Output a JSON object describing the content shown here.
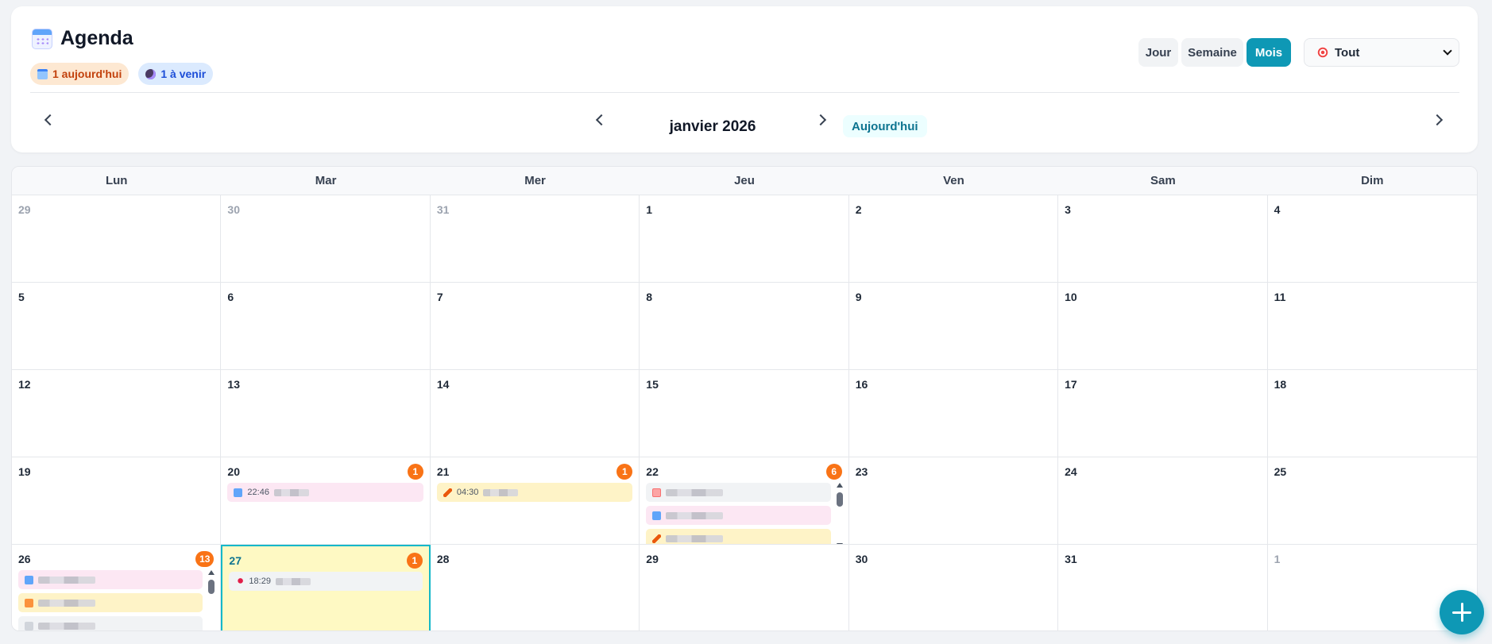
{
  "header": {
    "title": "Agenda",
    "icon": "calendar-icon",
    "badges": {
      "today": "1 aujourd'hui",
      "upcoming": "1 à venir"
    },
    "views": {
      "day": "Jour",
      "week": "Semaine",
      "month": "Mois",
      "active": "Mois"
    },
    "filter": {
      "selected": "Tout",
      "icon": "target-icon"
    },
    "nav": {
      "month_label": "janvier 2026",
      "today_button": "Aujourd'hui"
    }
  },
  "colors": {
    "accent": "#0e98b5",
    "count_badge": "#f97316",
    "today_cell": "#fef9c3"
  },
  "calendar": {
    "weekdays": [
      "Lun",
      "Mar",
      "Mer",
      "Jeu",
      "Ven",
      "Sam",
      "Dim"
    ],
    "days": [
      {
        "num": "29",
        "other": true
      },
      {
        "num": "30",
        "other": true
      },
      {
        "num": "31",
        "other": true
      },
      {
        "num": "1"
      },
      {
        "num": "2"
      },
      {
        "num": "3"
      },
      {
        "num": "4"
      },
      {
        "num": "5"
      },
      {
        "num": "6"
      },
      {
        "num": "7"
      },
      {
        "num": "8"
      },
      {
        "num": "9"
      },
      {
        "num": "10"
      },
      {
        "num": "11"
      },
      {
        "num": "12"
      },
      {
        "num": "13"
      },
      {
        "num": "14"
      },
      {
        "num": "15"
      },
      {
        "num": "16"
      },
      {
        "num": "17"
      },
      {
        "num": "18"
      },
      {
        "num": "19"
      },
      {
        "num": "20",
        "count": "1",
        "events": [
          {
            "time": "22:46",
            "color": "pink",
            "icon": "blue"
          }
        ]
      },
      {
        "num": "21",
        "count": "1",
        "events": [
          {
            "time": "04:30",
            "color": "yellow",
            "icon": "pencil"
          }
        ]
      },
      {
        "num": "22",
        "count": "6",
        "scroll": true,
        "events": [
          {
            "time": "",
            "color": "gray",
            "icon": "doc"
          },
          {
            "time": "",
            "color": "pink",
            "icon": "blue"
          },
          {
            "time": "",
            "color": "yellow",
            "icon": "pencil"
          }
        ]
      },
      {
        "num": "23"
      },
      {
        "num": "24"
      },
      {
        "num": "25"
      },
      {
        "num": "26",
        "count": "13",
        "scroll": true,
        "events": [
          {
            "time": "",
            "color": "pink",
            "icon": "blue"
          },
          {
            "time": "",
            "color": "yellow",
            "icon": "orange"
          },
          {
            "time": "",
            "color": "gray",
            "icon": "gray"
          }
        ]
      },
      {
        "num": "27",
        "today": true,
        "count": "1",
        "events": [
          {
            "time": "18:29",
            "color": "gray",
            "icon": "pin"
          }
        ]
      },
      {
        "num": "28"
      },
      {
        "num": "29"
      },
      {
        "num": "30"
      },
      {
        "num": "31"
      },
      {
        "num": "1",
        "other": true
      }
    ]
  },
  "fab": {
    "icon": "plus-icon"
  }
}
